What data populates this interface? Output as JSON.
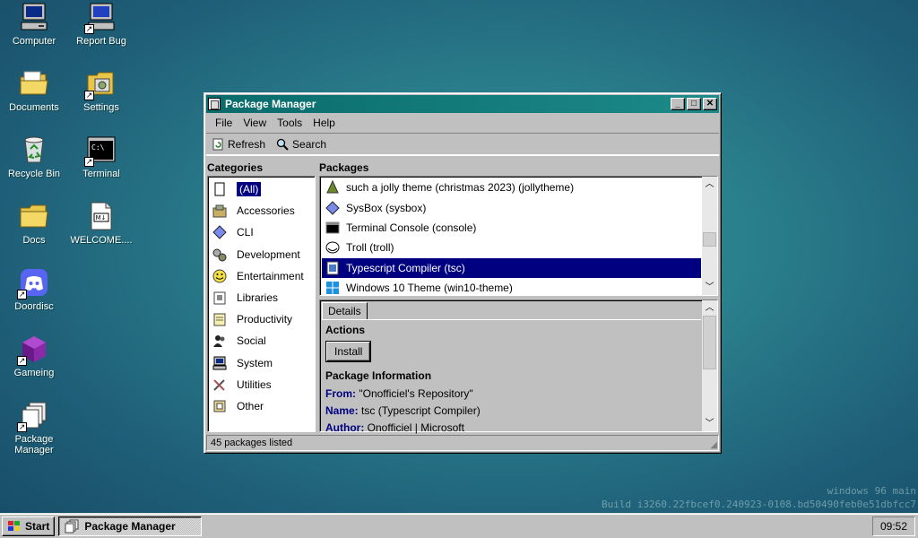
{
  "desktop": {
    "icons": [
      {
        "label": "Computer"
      },
      {
        "label": "Report Bug"
      },
      {
        "label": "Documents"
      },
      {
        "label": "Settings"
      },
      {
        "label": "Recycle Bin"
      },
      {
        "label": "Terminal"
      },
      {
        "label": "Docs"
      },
      {
        "label": "WELCOME...."
      },
      {
        "label": "Doordisc"
      },
      {
        "label": "Gameing"
      },
      {
        "label": "Package Manager"
      }
    ],
    "watermark_line1": "windows 96 main",
    "watermark_line2": "Build i3260.22fbcef0.240923-0108.bd50490feb0e51dbfcc7"
  },
  "window": {
    "title": "Package Manager",
    "controls": {
      "minimize": "_",
      "maximize": "□",
      "close": "✕"
    },
    "menu": [
      "File",
      "View",
      "Tools",
      "Help"
    ],
    "toolbar": {
      "refresh_label": "Refresh",
      "search_label": "Search"
    },
    "categories_header": "Categories",
    "packages_header": "Packages",
    "categories": [
      {
        "label": "(All)",
        "icon": "doc-icon",
        "selected": true
      },
      {
        "label": "Accessories",
        "icon": "accessories-icon"
      },
      {
        "label": "CLI",
        "icon": "diamond-icon"
      },
      {
        "label": "Development",
        "icon": "gears-icon"
      },
      {
        "label": "Entertainment",
        "icon": "smiley-icon"
      },
      {
        "label": "Libraries",
        "icon": "library-icon"
      },
      {
        "label": "Productivity",
        "icon": "notepad-icon"
      },
      {
        "label": "Social",
        "icon": "people-icon"
      },
      {
        "label": "System",
        "icon": "computer-icon"
      },
      {
        "label": "Utilities",
        "icon": "tools-icon"
      },
      {
        "label": "Other",
        "icon": "other-icon"
      }
    ],
    "packages": [
      {
        "label": "such a jolly theme (christmas 2023) (jollytheme)",
        "icon": "tree-icon"
      },
      {
        "label": "SysBox (sysbox)",
        "icon": "diamond-icon"
      },
      {
        "label": "Terminal Console (console)",
        "icon": "console-icon"
      },
      {
        "label": "Troll (troll)",
        "icon": "troll-icon"
      },
      {
        "label": "Typescript Compiler (tsc)",
        "icon": "file-icon",
        "selected": true
      },
      {
        "label": "Windows 10 Theme (win10-theme)",
        "icon": "windows-logo-icon"
      }
    ],
    "details": {
      "tab_label": "Details",
      "actions_heading": "Actions",
      "install_label": "Install",
      "info_heading": "Package Information",
      "from_key": "From:",
      "from_value": "\"Onofficiel's Repository\"",
      "name_key": "Name:",
      "name_value": "tsc (Typescript Compiler)",
      "author_key": "Author:",
      "author_value": "Onofficiel | Microsoft"
    },
    "status": "45 packages listed"
  },
  "taskbar": {
    "start_label": "Start",
    "task_label": "Package Manager",
    "clock": "09:52"
  }
}
